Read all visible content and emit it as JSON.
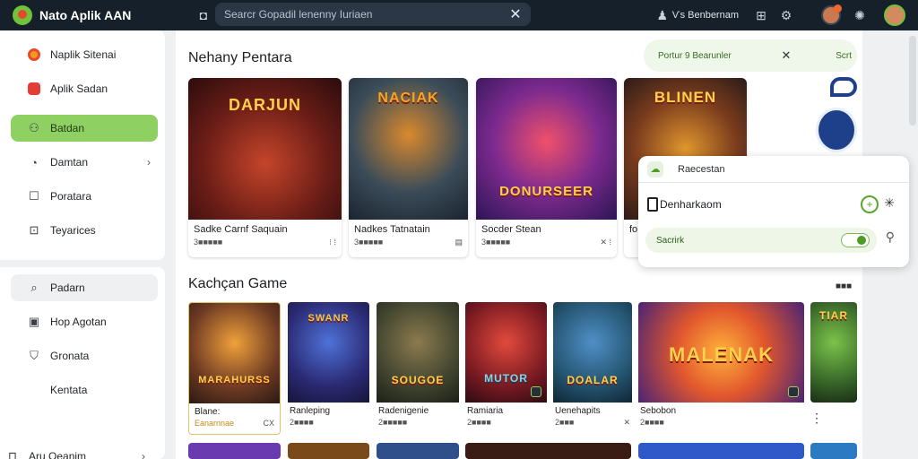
{
  "topbar": {
    "app_name": "Nato Aplik AAN",
    "search_placeholder": "Searcr Gopadil lenenny Iuriaen",
    "user_label": "Ѵs Benbernam"
  },
  "sidebar": {
    "group1": [
      {
        "label": "Naplik Sitenai",
        "icon": "orange-circle-icon"
      },
      {
        "label": "Aplik Sadan",
        "icon": "red-square-icon"
      },
      {
        "label": "Batdan",
        "icon": "controller-icon",
        "active": true
      },
      {
        "label": "Damtan",
        "icon": "gauge-icon",
        "chevron": true
      },
      {
        "label": "Poratara",
        "icon": "square-icon"
      },
      {
        "label": "Teyarices",
        "icon": "bookmark-icon"
      }
    ],
    "group2": [
      {
        "label": "Padarn",
        "icon": "search-icon",
        "soft": true
      },
      {
        "label": "Hop Agotan",
        "icon": "window-icon"
      },
      {
        "label": "Gronata",
        "icon": "shield-icon"
      },
      {
        "label": "Kentata",
        "icon": ""
      }
    ],
    "footer_label": "Aru Oeanim"
  },
  "sections": {
    "featured_title": "Nehany Pentara",
    "games_title": "Kachçan Game",
    "games_more": "■■■"
  },
  "featured": [
    {
      "art_title": "DARJUN",
      "name": "Sadke Carnf Saquain",
      "meta_left": "3■■■■■",
      "meta_right": "⁝ ⁞"
    },
    {
      "art_title": "NACIAK",
      "name": "Nadkes Tatnatain",
      "meta_left": "3■■■■■",
      "meta_right": "▤"
    },
    {
      "art_title": "DONURSEER",
      "name": "Socder Stean",
      "meta_left": "3■■■■■",
      "meta_right": "✕ ⁞"
    },
    {
      "art_title": "BLINEN",
      "name": "fo",
      "meta_left": "",
      "meta_right": ""
    }
  ],
  "games": [
    {
      "art_title": "MARAHURSS",
      "name": "Blane:",
      "meta_left": "Eanarnnae",
      "meta_right": "CX"
    },
    {
      "art_title": "SWANR",
      "name": "Ranleping",
      "meta_left": "2■■■■",
      "meta_right": ""
    },
    {
      "art_title": "SOUGOE",
      "name": "Radenigenie",
      "meta_left": "2■■■■■",
      "meta_right": ""
    },
    {
      "art_title": "MUTOR",
      "name": "Ramiaria",
      "meta_left": "2■■■■",
      "meta_right": ""
    },
    {
      "art_title": "DOALAR",
      "name": "Uenehapits",
      "meta_left": "2■■■",
      "meta_right": "✕"
    },
    {
      "art_title": "MALENAK",
      "name": "Sebobon",
      "meta_left": "2■■■■",
      "meta_right": ""
    },
    {
      "art_title": "TIAR",
      "name": "",
      "meta_left": "",
      "meta_right": ""
    }
  ],
  "banner": {
    "text": "Portur 9 Bearunler",
    "action": "Scrt"
  },
  "popover": {
    "header": "Raecestan",
    "row_label": "Denharkaom",
    "toggle_label": "Sacrirk"
  }
}
